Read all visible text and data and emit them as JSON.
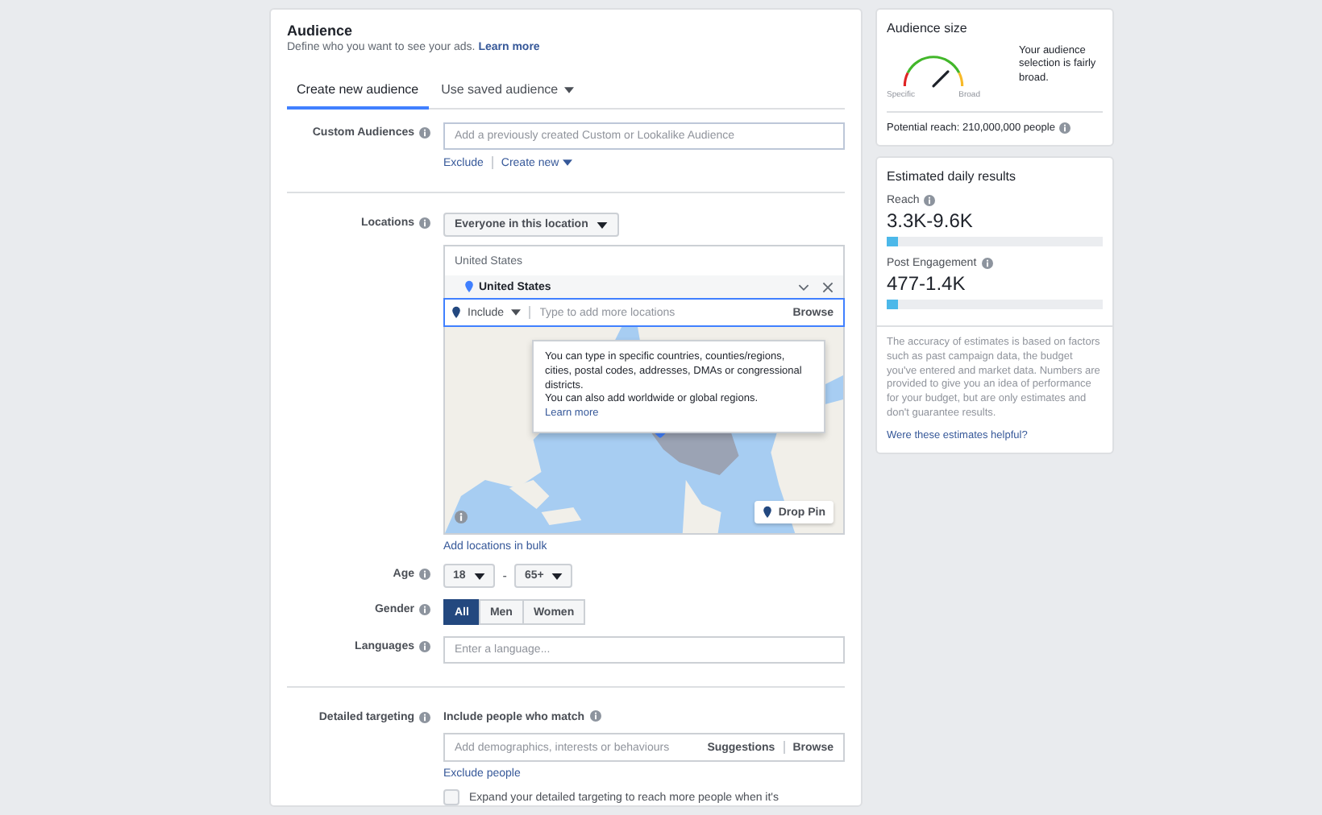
{
  "audience": {
    "title": "Audience",
    "subtitle": "Define who you want to see your ads.",
    "subtitle_link": "Learn more",
    "tabs": [
      {
        "label": "Create new audience",
        "selected": true
      },
      {
        "label": "Use saved audience",
        "selected": false
      }
    ],
    "custom_audiences": {
      "label": "Custom Audiences",
      "placeholder": "Add a previously created Custom or Lookalike Audience",
      "links": [
        "Exclude",
        "Create new"
      ]
    },
    "locations": {
      "label": "Locations",
      "dropdown": "Everyone in this location",
      "group_header": "United States",
      "selected_location": "United States",
      "include": "Include",
      "placeholder": "Type to add more locations",
      "browse": "Browse",
      "tooltip": {
        "text": "You can type in specific countries, counties/regions, cities, postal codes, addresses, DMAs or congressional districts.\nYou can also add worldwide or global regions.",
        "link": "Learn more"
      },
      "drop_pin": "Drop Pin",
      "bulk_link": "Add locations in bulk"
    },
    "age": {
      "label": "Age",
      "min": "18",
      "separator": "-",
      "max": "65+"
    },
    "gender": {
      "label": "Gender",
      "options": [
        {
          "label": "All",
          "selected": true
        },
        {
          "label": "Men",
          "selected": false
        },
        {
          "label": "Women",
          "selected": false
        }
      ]
    },
    "languages": {
      "label": "Languages",
      "placeholder": "Enter a language..."
    },
    "detailed_targeting": {
      "label": "Detailed targeting",
      "sublabel": "Include people who match",
      "placeholder": "Add demographics, interests or behaviours",
      "buttons": [
        "Suggestions",
        "Browse"
      ],
      "exclude_link": "Exclude people",
      "expand_text": "Expand your detailed targeting to reach more people when it's",
      "expand_checked": false
    }
  },
  "audience_size": {
    "title": "Audience size",
    "gauge": {
      "labels": [
        "Specific",
        "Broad"
      ]
    },
    "description": "Your audience selection is fairly broad.",
    "potential_reach": "Potential reach: 210,000,000 people"
  },
  "estimated_results": {
    "title": "Estimated daily results",
    "metrics": [
      {
        "label": "Reach",
        "value": "3.3K-9.6K",
        "level": 0.05
      },
      {
        "label": "Post Engagement",
        "value": "477-1.4K",
        "level": 0.05
      }
    ],
    "note": "The accuracy of estimates is based on factors such as past campaign data, the budget you've entered and market data. Numbers are provided to give you an idea of performance for your budget, but are only estimates and don't guarantee results.",
    "feedback_link": "Were these estimates helpful?"
  }
}
